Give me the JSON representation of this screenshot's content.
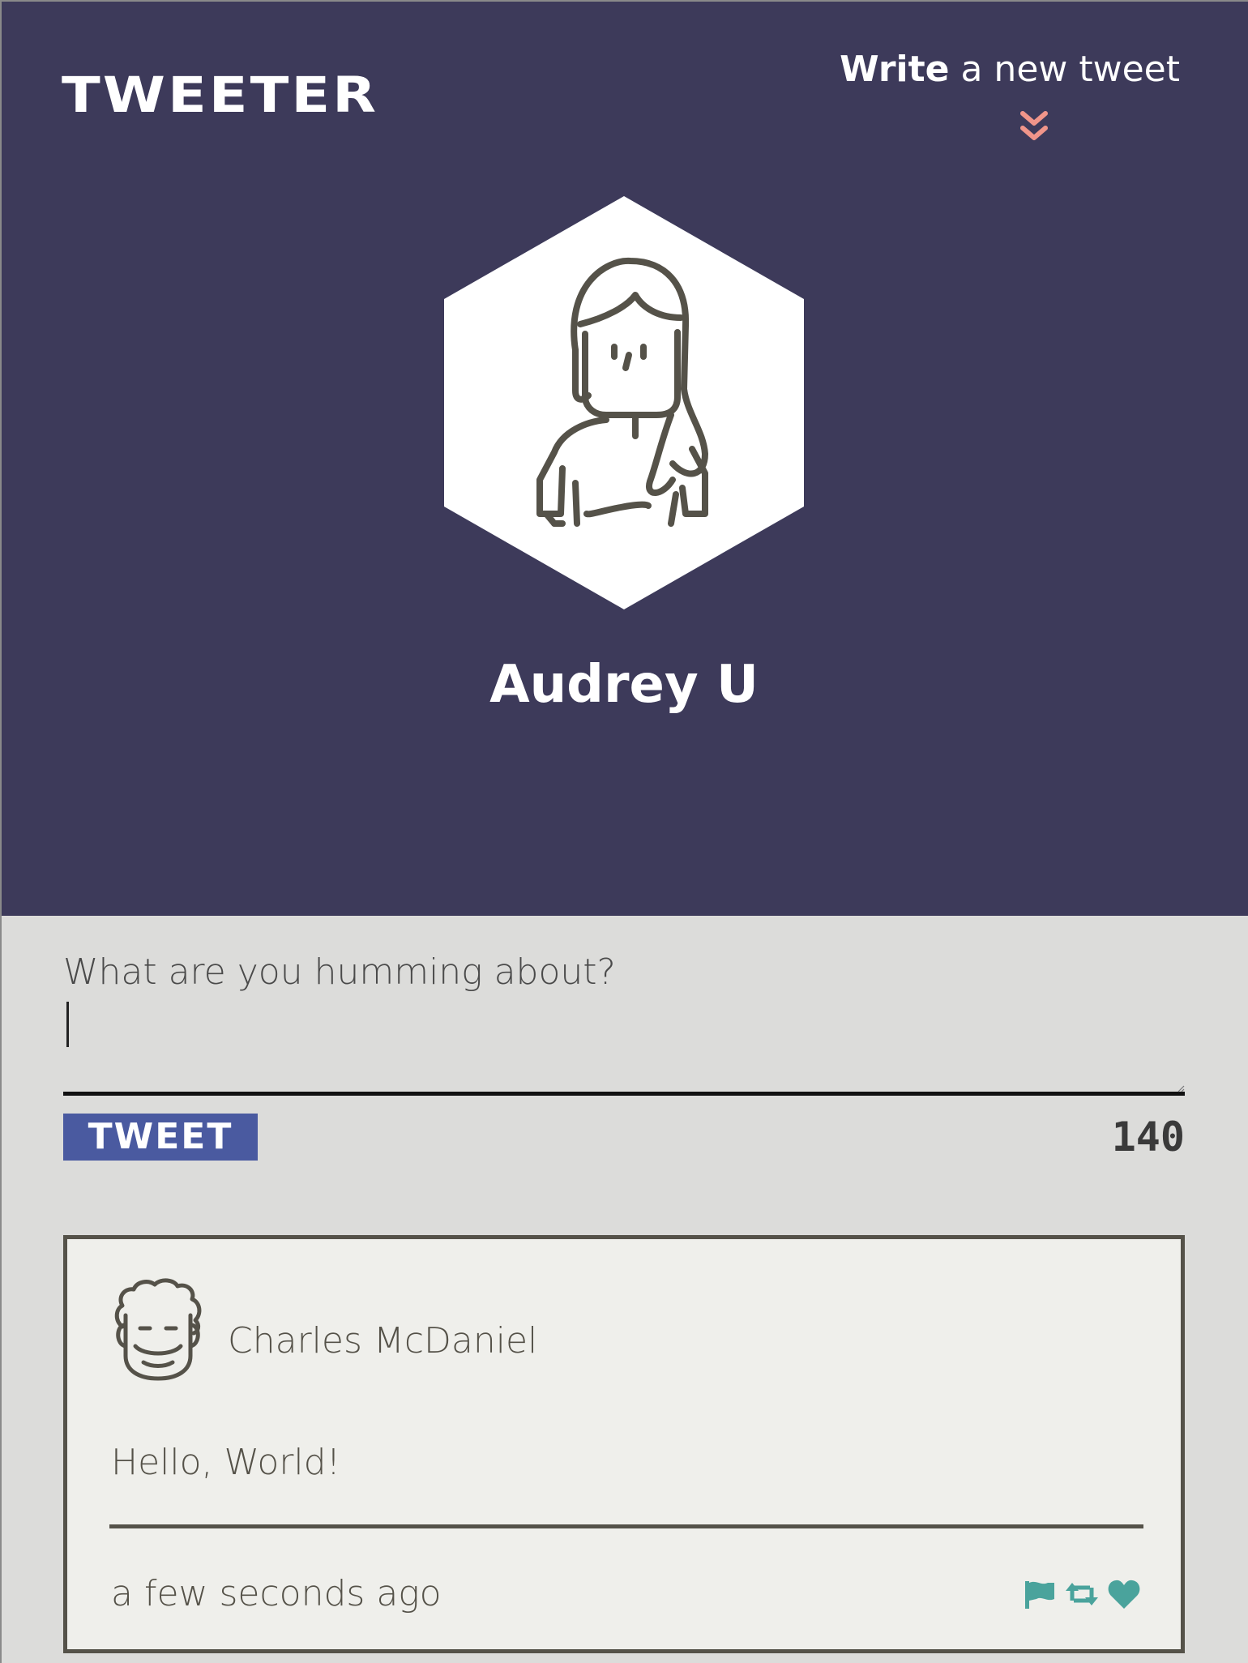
{
  "header": {
    "brand": "TWEETER",
    "compose_toggle": {
      "strong": "Write",
      "light": "a new tweet",
      "icon": "double-chevron-down-icon"
    },
    "user": {
      "name": "Audrey U",
      "avatar_icon": "woman-avatar-icon"
    }
  },
  "compose": {
    "placeholder": "What are you humming about?",
    "value": "",
    "submit_label": "TWEET",
    "char_count": "140"
  },
  "tweets": [
    {
      "author": "Charles McDaniel",
      "avatar_icon": "man-curly-hair-avatar-icon",
      "body": "Hello, World!",
      "timestamp": "a few seconds ago",
      "actions": [
        "flag-icon",
        "retweet-icon",
        "heart-icon"
      ]
    }
  ],
  "colors": {
    "header_bg": "#3d3a5a",
    "page_bg": "#dcdcda",
    "card_bg": "#efefeb",
    "button_bg": "#4a5aa0",
    "accent_chevron": "#f0958a",
    "action_icons": "#4aa39c",
    "text_dark": "#555249"
  }
}
